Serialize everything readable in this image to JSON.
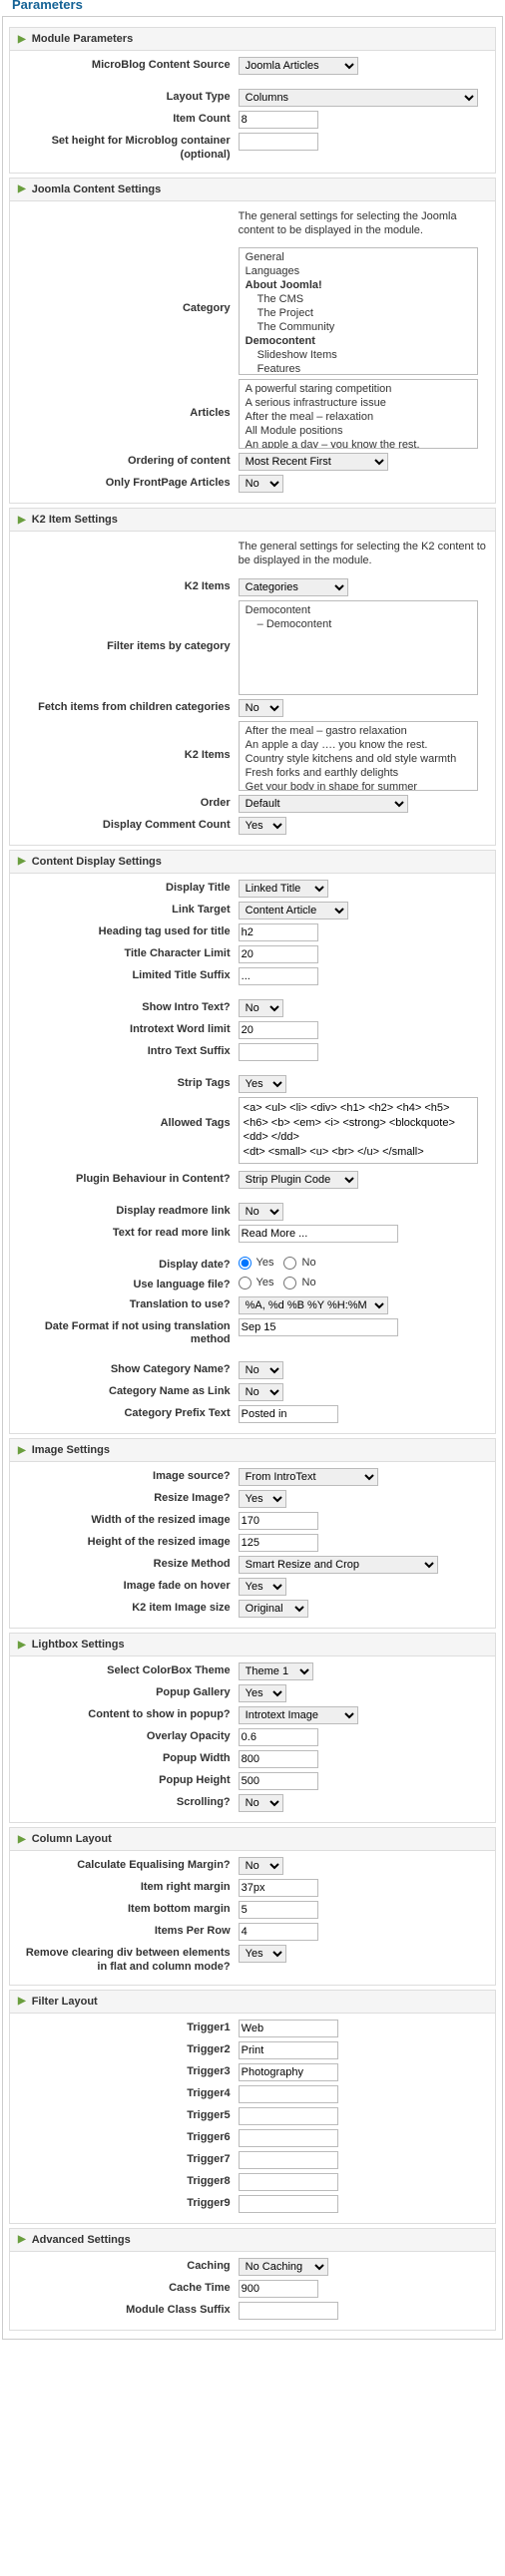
{
  "panel_title": "Parameters",
  "module_params": {
    "title": "Module Parameters",
    "source_label": "MicroBlog Content Source",
    "source": "Joomla Articles",
    "layout_type_label": "Layout Type",
    "layout_type": "Columns",
    "item_count_label": "Item Count",
    "item_count": "8",
    "set_height_label": "Set height for Microblog container (optional)",
    "set_height": ""
  },
  "joomla": {
    "title": "Joomla Content Settings",
    "desc": "The general settings for selecting the Joomla content to be displayed in the module.",
    "category_label": "Category",
    "categories": [
      {
        "t": "General",
        "i": 0,
        "s": false
      },
      {
        "t": "Languages",
        "i": 0,
        "s": false
      },
      {
        "t": "About Joomla!",
        "i": 0,
        "s": false,
        "b": true
      },
      {
        "t": "The CMS",
        "i": 1,
        "s": false
      },
      {
        "t": "The Project",
        "i": 1,
        "s": false
      },
      {
        "t": "The Community",
        "i": 1,
        "s": false
      },
      {
        "t": "Democontent",
        "i": 0,
        "s": false,
        "b": true
      },
      {
        "t": "Slideshow Items",
        "i": 1,
        "s": false
      },
      {
        "t": "Features",
        "i": 1,
        "s": false
      },
      {
        "t": "Democontent",
        "i": 1,
        "s": true
      }
    ],
    "articles_label": "Articles",
    "articles": "A powerful staring competition\nA serious infrastructure issue\nAfter the meal – relaxation\nAll Module positions\nAn apple a day – you know the rest.",
    "ordering_label": "Ordering of content",
    "ordering": "Most Recent First",
    "frontpage_label": "Only FrontPage Articles",
    "frontpage": "No"
  },
  "k2": {
    "title": "K2 Item Settings",
    "desc": "The general settings for selecting the K2 content to be displayed in the module.",
    "items_label": "K2 Items",
    "items": "Categories",
    "filter_label": "Filter items by category",
    "filter_cats": [
      {
        "t": "Democontent",
        "i": 0,
        "s": false
      },
      {
        "t": "– Democontent",
        "i": 1,
        "s": false
      }
    ],
    "fetch_label": "Fetch items from children categories",
    "fetch": "No",
    "k2items_label": "K2 Items",
    "k2items": "After the meal – gastro relaxation\nAn apple a day …. you know the rest.\nCountry style kitchens and old style warmth\nFresh forks and earthly delights\nGet your body in shape for summer",
    "order_label": "Order",
    "order": "Default",
    "comment_label": "Display Comment Count",
    "comment": "Yes"
  },
  "content": {
    "title": "Content Display Settings",
    "display_title_label": "Display Title",
    "display_title": "Linked Title",
    "link_target_label": "Link Target",
    "link_target": "Content Article",
    "heading_tag_label": "Heading tag used for title",
    "heading_tag": "h2",
    "title_limit_label": "Title Character Limit",
    "title_limit": "20",
    "title_suffix_label": "Limited Title Suffix",
    "title_suffix": "...",
    "show_intro_label": "Show Intro Text?",
    "show_intro": "No",
    "intro_limit_label": "Introtext Word limit",
    "intro_limit": "20",
    "intro_suffix_label": "Intro Text Suffix",
    "intro_suffix": "",
    "strip_tags_label": "Strip Tags",
    "strip_tags": "Yes",
    "allowed_tags_label": "Allowed Tags",
    "allowed_tags": "<a> <ul> <li> <div> <h1> <h2> <h4> <h5> <h6> <b> <em> <i> <strong> <blockquote>\n<dd> </dd>\n<dt> <small> <u> <br> </u> </small>",
    "plugin_label": "Plugin Behaviour in Content?",
    "plugin": "Strip Plugin Code",
    "readmore_label": "Display readmore link",
    "readmore": "No",
    "readmore_text_label": "Text for read more link",
    "readmore_text": "Read More ...",
    "display_date_label": "Display date?",
    "display_date": "Yes",
    "use_lang_label": "Use language file?",
    "use_lang": "Yes",
    "translation_label": "Translation to use?",
    "translation": "%A, %d %B %Y %H:%M",
    "date_format_label": "Date Format if not using translation method",
    "date_format": "Sep 15",
    "show_cat_label": "Show Category Name?",
    "show_cat": "No",
    "cat_link_label": "Category Name as Link",
    "cat_link": "No",
    "cat_prefix_label": "Category Prefix Text",
    "cat_prefix": "Posted in"
  },
  "image": {
    "title": "Image Settings",
    "source_label": "Image source?",
    "source": "From IntroText",
    "resize_label": "Resize Image?",
    "resize": "Yes",
    "width_label": "Width of the resized image",
    "width": "170",
    "height_label": "Height of the resized image",
    "height": "125",
    "method_label": "Resize Method",
    "method": "Smart Resize and Crop",
    "fade_label": "Image fade on hover",
    "fade": "Yes",
    "k2size_label": "K2 item Image size",
    "k2size": "Original"
  },
  "lightbox": {
    "title": "Lightbox Settings",
    "theme_label": "Select ColorBox Theme",
    "theme": "Theme 1",
    "gallery_label": "Popup Gallery",
    "gallery": "Yes",
    "content_label": "Content to show in popup?",
    "content": "Introtext Image",
    "opacity_label": "Overlay Opacity",
    "opacity": "0.6",
    "pwidth_label": "Popup Width",
    "pwidth": "800",
    "pheight_label": "Popup Height",
    "pheight": "500",
    "scrolling_label": "Scrolling?",
    "scrolling": "No"
  },
  "column": {
    "title": "Column Layout",
    "equal_label": "Calculate Equalising Margin?",
    "equal": "No",
    "right_margin_label": "Item right margin",
    "right_margin": "37px",
    "bottom_margin_label": "Item bottom margin",
    "bottom_margin": "5",
    "per_row_label": "Items Per Row",
    "per_row": "4",
    "clearing_label": "Remove clearing div between elements in flat and column mode?",
    "clearing": "Yes"
  },
  "filter": {
    "title": "Filter Layout",
    "t1l": "Trigger1",
    "t1": "Web",
    "t2l": "Trigger2",
    "t2": "Print",
    "t3l": "Trigger3",
    "t3": "Photography",
    "t4l": "Trigger4",
    "t4": "",
    "t5l": "Trigger5",
    "t5": "",
    "t6l": "Trigger6",
    "t6": "",
    "t7l": "Trigger7",
    "t7": "",
    "t8l": "Trigger8",
    "t8": "",
    "t9l": "Trigger9",
    "t9": ""
  },
  "advanced": {
    "title": "Advanced Settings",
    "caching_label": "Caching",
    "caching": "No Caching",
    "cache_time_label": "Cache Time",
    "cache_time": "900",
    "suffix_label": "Module Class Suffix",
    "suffix": ""
  },
  "radio_yes": "Yes",
  "radio_no": "No"
}
